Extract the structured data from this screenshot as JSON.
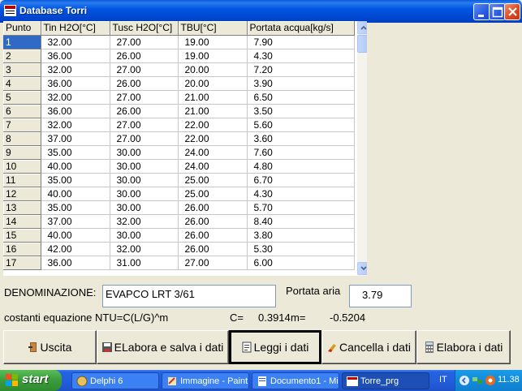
{
  "window": {
    "title": "Database Torri"
  },
  "grid": {
    "columns": [
      "Punto",
      "Tin H2O[°C]",
      "Tusc H2O[°C]",
      "TBU[°C]",
      "Portata acqua[kg/s]"
    ],
    "rows": [
      [
        "1",
        "32.00",
        "27.00",
        "19.00",
        "7.90"
      ],
      [
        "2",
        "36.00",
        "26.00",
        "19.00",
        "4.30"
      ],
      [
        "3",
        "32.00",
        "27.00",
        "20.00",
        "7.20"
      ],
      [
        "4",
        "36.00",
        "26.00",
        "20.00",
        "3.90"
      ],
      [
        "5",
        "32.00",
        "27.00",
        "21.00",
        "6.50"
      ],
      [
        "6",
        "36.00",
        "26.00",
        "21.00",
        "3.50"
      ],
      [
        "7",
        "32.00",
        "27.00",
        "22.00",
        "5.60"
      ],
      [
        "8",
        "37.00",
        "27.00",
        "22.00",
        "3.60"
      ],
      [
        "9",
        "35.00",
        "30.00",
        "24.00",
        "7.60"
      ],
      [
        "10",
        "40.00",
        "30.00",
        "24.00",
        "4.80"
      ],
      [
        "11",
        "35.00",
        "30.00",
        "25.00",
        "6.70"
      ],
      [
        "12",
        "40.00",
        "30.00",
        "25.00",
        "4.30"
      ],
      [
        "13",
        "35.00",
        "30.00",
        "26.00",
        "5.70"
      ],
      [
        "14",
        "37.00",
        "32.00",
        "26.00",
        "8.40"
      ],
      [
        "15",
        "40.00",
        "30.00",
        "26.00",
        "3.80"
      ],
      [
        "16",
        "42.00",
        "32.00",
        "26.00",
        "5.30"
      ],
      [
        "17",
        "36.00",
        "31.00",
        "27.00",
        "6.00"
      ]
    ],
    "selected_row": "1"
  },
  "form": {
    "denominazione_label": "DENOMINAZIONE:",
    "denominazione_value": "EVAPCO LRT 3/61",
    "portata_aria_label": "Portata aria",
    "portata_aria_value": "3.79",
    "equation_label": "costanti equazione NTU=C(L/G)^m",
    "c_label": "C=",
    "c_value": "0.3914",
    "m_label": "m=",
    "m_value": "-0.5204"
  },
  "buttons": {
    "uscita": "Uscita",
    "elabora_salva": "ELabora e salva i dati",
    "leggi": "Leggi  i dati",
    "cancella": "Cancella  i dati",
    "elabora": "Elabora i dati"
  },
  "taskbar": {
    "start": "start",
    "tasks": [
      "Delphi 6",
      "Immagine - Paint",
      "Documento1 - Mi...",
      "Torre_prg"
    ],
    "language": "IT",
    "clock": "11.38"
  },
  "icons": [
    "app-icon",
    "minimize-icon",
    "maximize-icon",
    "close-icon",
    "exit-icon",
    "save-icon",
    "read-icon",
    "eraser-icon",
    "calculator-icon",
    "windows-logo-icon"
  ]
}
